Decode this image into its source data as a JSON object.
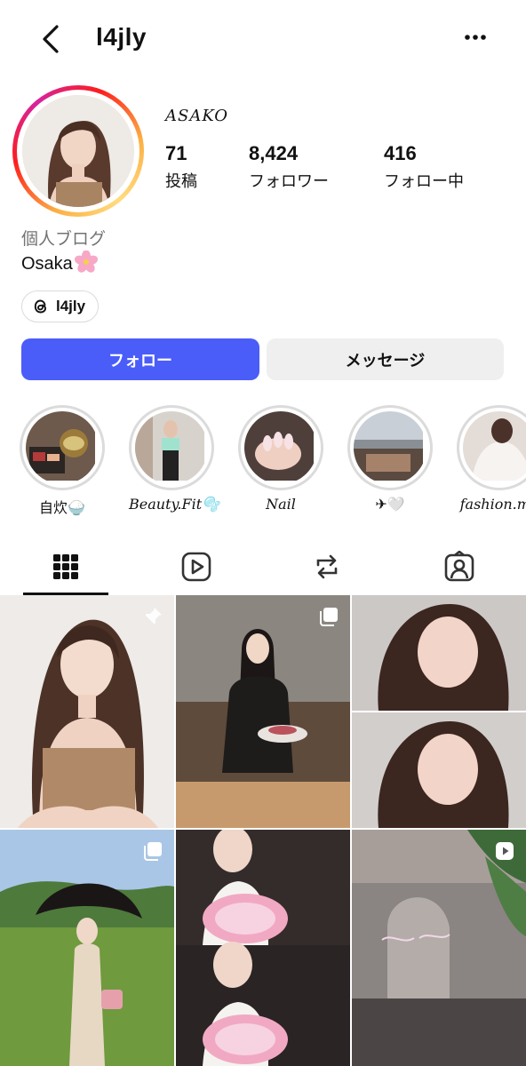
{
  "header": {
    "username": "l4jly",
    "back_icon": "chevron-left-icon",
    "more_icon": "more-horizontal-icon"
  },
  "profile": {
    "display_name": "ASAKO",
    "stats": [
      {
        "value": "71",
        "label": "投稿"
      },
      {
        "value": "8,424",
        "label": "フォロワー"
      },
      {
        "value": "416",
        "label": "フォロー中"
      }
    ],
    "category": "個人ブログ",
    "bio": "Osaka",
    "bio_emoji": "cherry-blossom-icon",
    "threads_handle": "l4jly"
  },
  "actions": {
    "follow_label": "フォロー",
    "message_label": "メッセージ"
  },
  "highlights": [
    {
      "label": "自炊🍚"
    },
    {
      "label": "Beauty.Fit🫧"
    },
    {
      "label": "Nail"
    },
    {
      "label": "✈︎🤍"
    },
    {
      "label": "fashion.me"
    }
  ],
  "tabs": [
    {
      "icon": "grid-icon",
      "active": true
    },
    {
      "icon": "reels-icon",
      "active": false
    },
    {
      "icon": "reposts-icon",
      "active": false
    },
    {
      "icon": "tagged-icon",
      "active": false
    }
  ],
  "posts": [
    {
      "badge": "pin-icon"
    },
    {
      "badge": "carousel-icon"
    },
    {
      "badge": ""
    },
    {
      "badge": "carousel-icon"
    },
    {
      "badge": ""
    },
    {
      "badge": "reel-icon"
    }
  ],
  "colors": {
    "follow_button": "#4a5df9",
    "secondary_button": "#efefef",
    "muted_text": "#737373"
  }
}
